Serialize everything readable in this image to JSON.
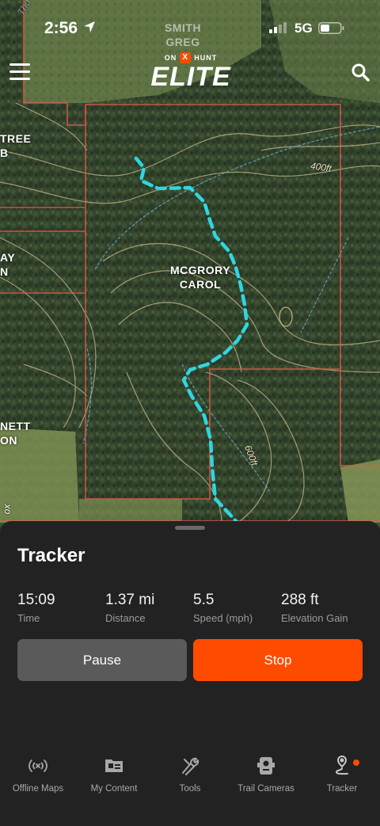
{
  "status": {
    "time": "2:56",
    "network": "5G"
  },
  "brand": {
    "top_left": "ON",
    "top_x": "X",
    "top_right": "HUNT",
    "main": "ELITE"
  },
  "map": {
    "owner_labels": [
      {
        "lines": [
          "SMITH",
          "GREG"
        ]
      },
      {
        "lines": [
          "TREE",
          "B"
        ]
      },
      {
        "lines": [
          "AY",
          "N"
        ]
      },
      {
        "lines": [
          "MCGRORY",
          "CAROL"
        ]
      },
      {
        "lines": [
          "NETT",
          "ON"
        ]
      }
    ],
    "contour_labels": [
      "400ft",
      "600ft"
    ],
    "road_label": "Tho",
    "edge_label": "ox",
    "track_color": "#2fd6e0",
    "boundary_color": "#e8574a"
  },
  "tracker": {
    "title": "Tracker",
    "stats": [
      {
        "value": "15:09",
        "label": "Time"
      },
      {
        "value": "1.37 mi",
        "label": "Distance"
      },
      {
        "value": "5.5",
        "label": "Speed (mph)"
      },
      {
        "value": "288 ft",
        "label": "Elevation Gain"
      }
    ],
    "pause_label": "Pause",
    "stop_label": "Stop"
  },
  "tabs": [
    {
      "label": "Offline Maps",
      "icon": "offline-signal-icon"
    },
    {
      "label": "My Content",
      "icon": "content-folder-icon"
    },
    {
      "label": "Tools",
      "icon": "tools-icon"
    },
    {
      "label": "Trail Cameras",
      "icon": "trail-camera-icon"
    },
    {
      "label": "Tracker",
      "icon": "tracker-pin-icon",
      "active_dot": true
    }
  ],
  "colors": {
    "accent": "#ff4b00",
    "sheet_bg": "#222222",
    "pause_bg": "#5a5a5a"
  }
}
